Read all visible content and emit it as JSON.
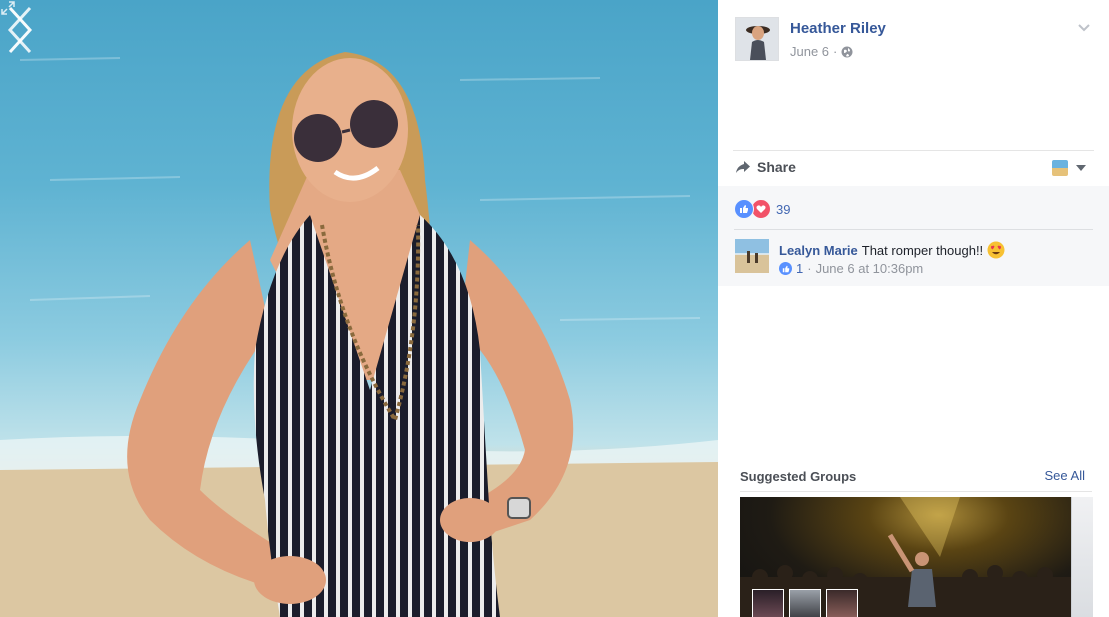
{
  "post": {
    "author_name": "Heather Riley",
    "date": "June 6",
    "separator": "·"
  },
  "actions": {
    "share_label": "Share"
  },
  "reactions": {
    "count": "39"
  },
  "comments": [
    {
      "author": "Lealyn Marie",
      "text": "That romper though!!",
      "like_count": "1",
      "separator": "·",
      "timestamp": "June 6 at 10:36pm"
    }
  ],
  "suggested_groups": {
    "title": "Suggested Groups",
    "see_all_label": "See All"
  },
  "colors": {
    "link_blue": "#365899",
    "like_blue": "#5890ff",
    "love_red": "#f25268",
    "panel_gray": "#f6f7f9"
  }
}
